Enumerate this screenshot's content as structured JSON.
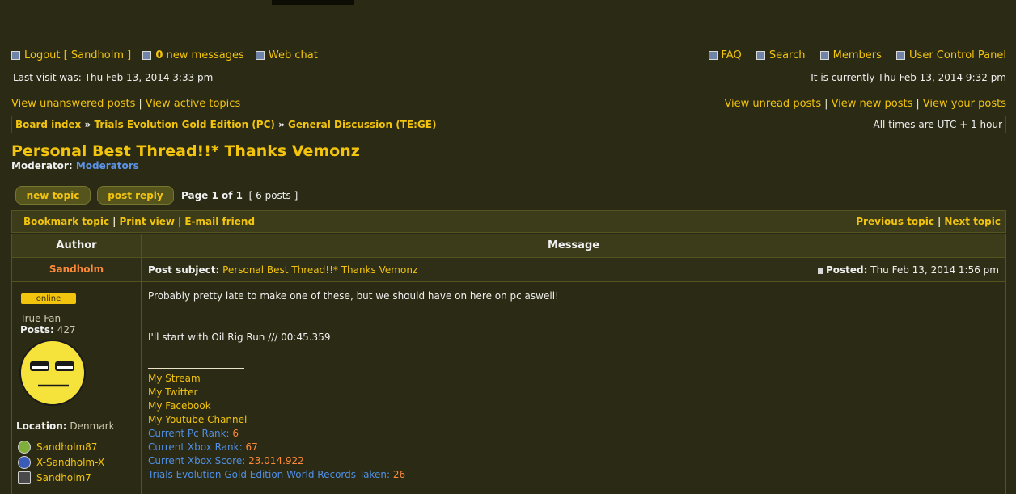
{
  "top_nav": {
    "logout": "Logout [ Sandholm ]",
    "new_messages_count": "0",
    "new_messages_label": " new messages",
    "web_chat": "Web chat",
    "faq": "FAQ",
    "search": "Search",
    "members": "Members",
    "ucp": "User Control Panel"
  },
  "visit": {
    "last_visit": "Last visit was: Thu Feb 13, 2014 3:33 pm",
    "current_time": "It is currently Thu Feb 13, 2014 9:32 pm"
  },
  "quick_links": {
    "unanswered": "View unanswered posts",
    "active": "View active topics",
    "unread": "View unread posts",
    "new_posts": "View new posts",
    "your_posts": "View your posts"
  },
  "breadcrumb": {
    "board_index": "Board index",
    "forum_parent": "Trials Evolution Gold Edition (PC)",
    "forum": "General Discussion (TE:GE)",
    "separator": "»",
    "timezone": "All times are UTC + 1 hour"
  },
  "topic": {
    "title": "Personal Best Thread!!* Thanks Vemonz",
    "moderator_label": "Moderator:",
    "moderator_link": "Moderators",
    "new_topic": "new topic",
    "post_reply": "post reply",
    "page_label": "Page 1 of 1",
    "posts_count": "[ 6 posts ]"
  },
  "actions": {
    "bookmark": "Bookmark topic",
    "print": "Print view",
    "email": "E-mail friend",
    "prev": "Previous topic",
    "next": "Next topic"
  },
  "table": {
    "author_header": "Author",
    "message_header": "Message"
  },
  "post": {
    "author": "Sandholm",
    "subject_label": "Post subject:",
    "subject": "Personal Best Thread!!* Thanks Vemonz",
    "posted_label": "Posted:",
    "posted_time": "Thu Feb 13, 2014 1:56 pm",
    "online": "online",
    "rank": "True Fan",
    "posts_label": "Posts:",
    "posts_value": "427",
    "location_label": "Location:",
    "location_value": "Denmark",
    "gamertags": [
      "Sandholm87",
      "X-Sandholm-X",
      "Sandholm7"
    ],
    "body_line1": "Probably pretty late to make one of these, but we should have on here on pc aswell!",
    "body_line2": "I'll start with Oil Rig Run /// 00:45.359",
    "signature": {
      "links": [
        "My Stream",
        "My Twitter",
        "My Facebook",
        "My Youtube Channel"
      ],
      "stats": [
        {
          "label": "Current Pc Rank: ",
          "value": "6"
        },
        {
          "label": "Current Xbox Rank: ",
          "value": "67"
        },
        {
          "label": "Current Xbox Score: ",
          "value": "23.014.922"
        },
        {
          "label": "Trials Evolution Gold Edition World Records Taken: ",
          "value": "26"
        }
      ]
    }
  },
  "colors": {
    "background": "#2b2a14",
    "link_yellow": "#f2c40e",
    "author_orange": "#ff8a3a",
    "stat_blue": "#4f8fe6"
  }
}
